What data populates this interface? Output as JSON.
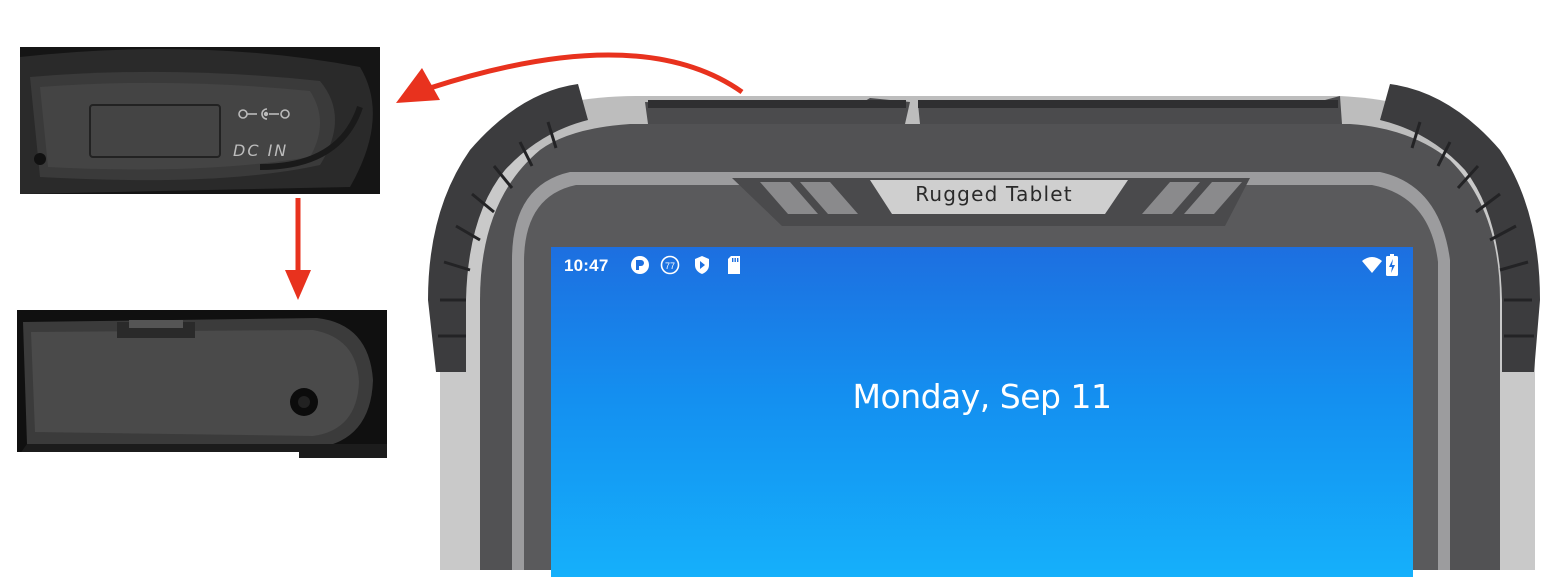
{
  "device": {
    "brand_label": "Rugged Tablet"
  },
  "port_cover": {
    "label": "DC IN",
    "icon": "dc-polarity-icon"
  },
  "status_bar": {
    "time": "10:47",
    "notification_icons": [
      "p-app-icon",
      "seventy-seven-icon",
      "play-shield-icon",
      "sd-card-icon"
    ],
    "notification_badge_text": "77",
    "right_icons": [
      "wifi-icon",
      "battery-charging-icon"
    ]
  },
  "lock_screen": {
    "date": "Monday, Sep 11"
  },
  "colors": {
    "arrow": "#e8321e",
    "screen_top": "#1d6fe0",
    "screen_bottom": "#15b0fb",
    "bezel": "#4a4a4c",
    "bumper": "#3c3c3e"
  }
}
